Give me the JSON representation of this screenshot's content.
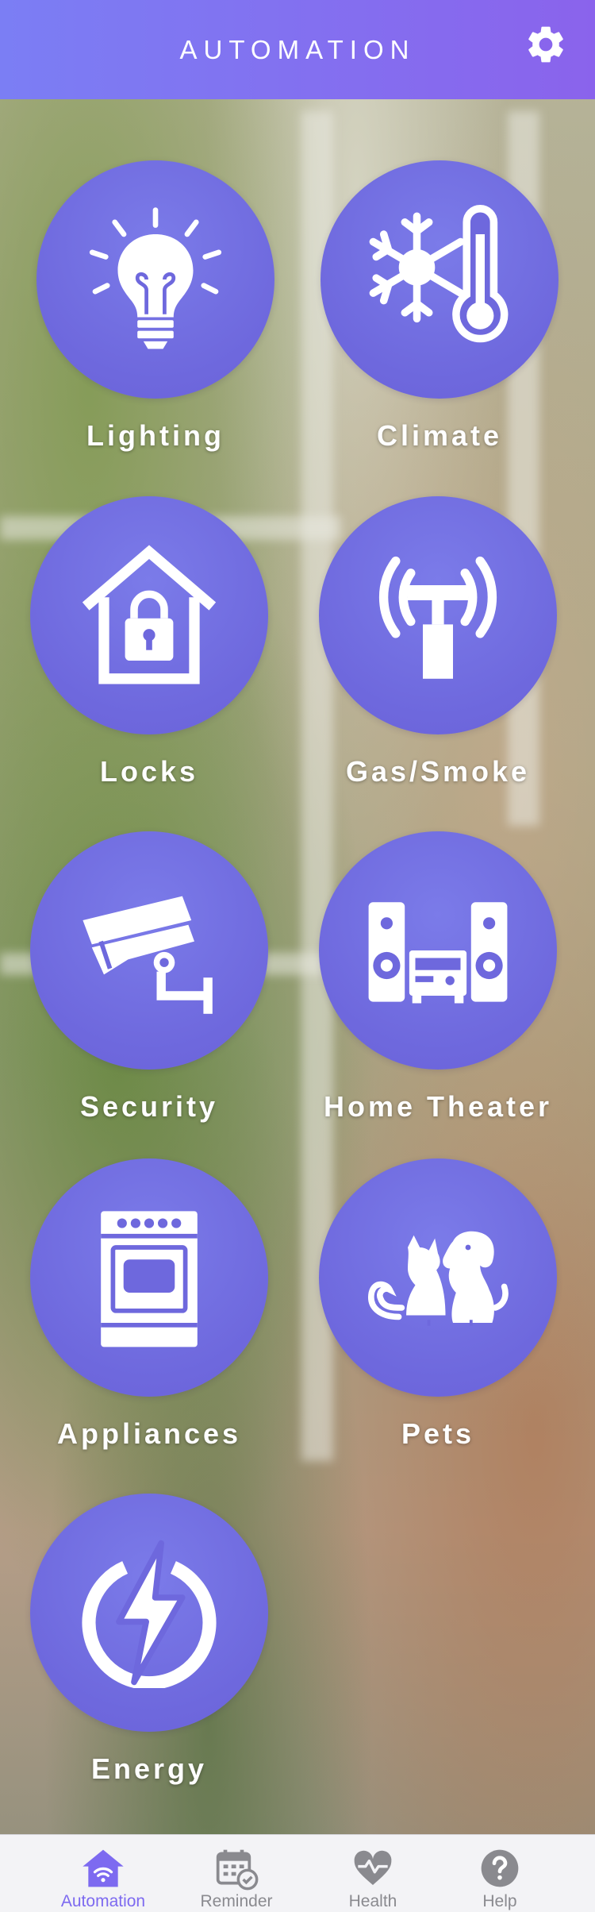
{
  "header": {
    "title": "AUTOMATION",
    "settings_icon": "gear-icon"
  },
  "tiles": [
    {
      "label": "Lighting",
      "icon": "lightbulb-icon"
    },
    {
      "label": "Climate",
      "icon": "snowflake-thermometer-icon"
    },
    {
      "label": "Locks",
      "icon": "house-lock-icon"
    },
    {
      "label": "Gas/Smoke",
      "icon": "sensor-signal-icon"
    },
    {
      "label": "Security",
      "icon": "security-camera-icon"
    },
    {
      "label": "Home Theater",
      "icon": "stereo-speakers-icon"
    },
    {
      "label": "Appliances",
      "icon": "stove-icon"
    },
    {
      "label": "Pets",
      "icon": "cat-dog-icon"
    },
    {
      "label": "Energy",
      "icon": "lightning-bolt-icon"
    }
  ],
  "tabbar": {
    "items": [
      {
        "label": "Automation",
        "icon": "home-wifi-icon",
        "active": true
      },
      {
        "label": "Reminder",
        "icon": "calendar-check-icon",
        "active": false
      },
      {
        "label": "Health",
        "icon": "heart-pulse-icon",
        "active": false
      },
      {
        "label": "Help",
        "icon": "question-icon",
        "active": false
      }
    ]
  },
  "colors": {
    "header_gradient_start": "#7b7ef4",
    "header_gradient_end": "#8a63ec",
    "tile_circle": "#6e68dd",
    "active_tab": "#7d6af0",
    "inactive_tab": "#8a8a8f"
  }
}
